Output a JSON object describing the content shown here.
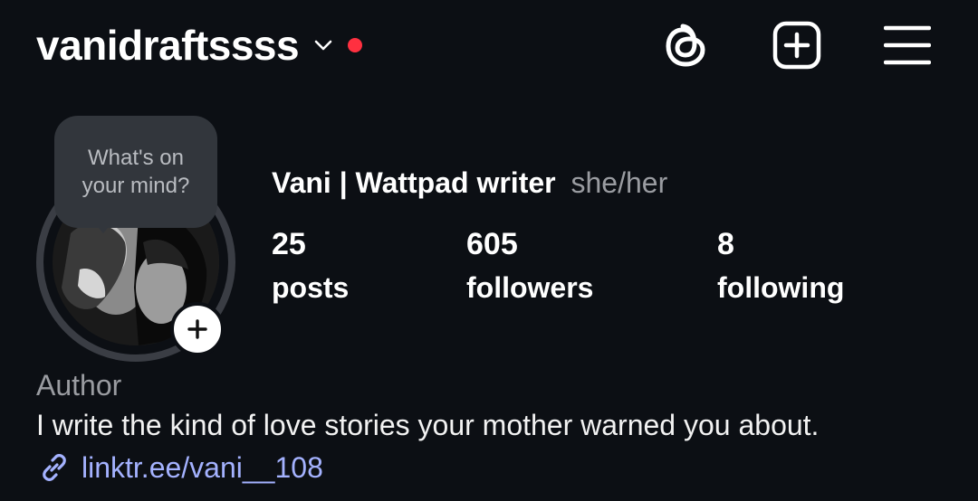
{
  "header": {
    "username": "vanidraftssss",
    "chevron_icon": "chevron-down-icon",
    "notification_dot_color": "#ff3040",
    "icons": [
      "threads-icon",
      "create-post-icon",
      "menu-icon"
    ]
  },
  "profile": {
    "note_bubble": "What's on your mind?",
    "avatar_icon": "profile-photo",
    "add_story_icon": "plus-icon",
    "display_name": "Vani | Wattpad writer",
    "pronouns": "she/her",
    "stats": [
      {
        "value": "25",
        "label": "posts"
      },
      {
        "value": "605",
        "label": "followers"
      },
      {
        "value": "8",
        "label": "following"
      }
    ]
  },
  "bio": {
    "category": "Author",
    "text": "I write the kind of love stories your mother warned you about.",
    "link_icon": "link-icon",
    "link": "linktr.ee/vani__108",
    "link_color": "#a4b2ff"
  }
}
